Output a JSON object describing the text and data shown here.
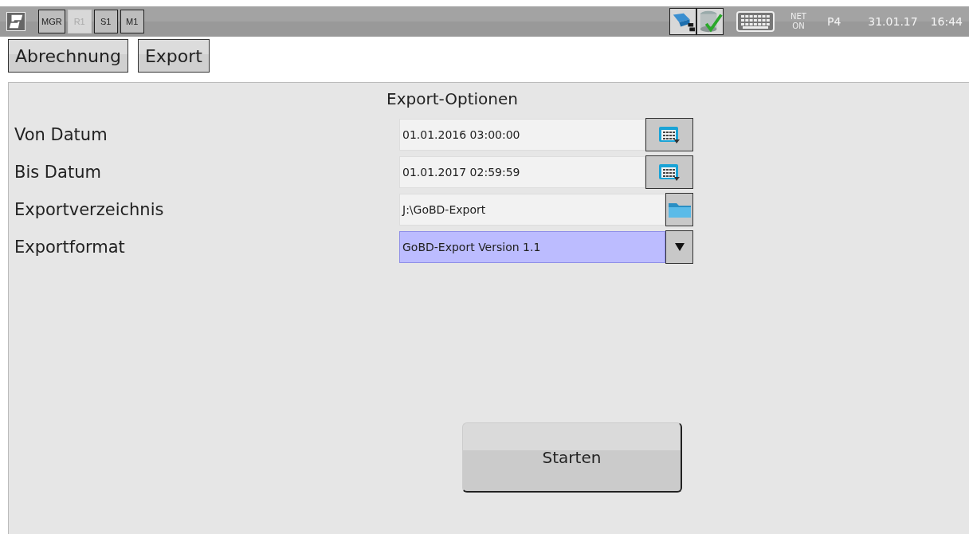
{
  "status_bar": {
    "modes": [
      {
        "label": "MGR",
        "disabled": false
      },
      {
        "label": "R1",
        "disabled": true
      },
      {
        "label": "S1",
        "disabled": false
      },
      {
        "label": "M1",
        "disabled": false
      }
    ],
    "net": [
      "NET",
      "ON"
    ],
    "printer": "P4",
    "date": "31.01.17",
    "time": "16:44"
  },
  "tabs": [
    {
      "label": "Abrechnung"
    },
    {
      "label": "Export"
    }
  ],
  "panel": {
    "title": "Export-Optionen",
    "rows": [
      {
        "label": "Von Datum",
        "value": "01.01.2016 03:00:00",
        "kind": "date",
        "highlighted": false
      },
      {
        "label": "Bis Datum",
        "value": "01.01.2017 02:59:59",
        "kind": "date",
        "highlighted": false
      },
      {
        "label": "Exportverzeichnis",
        "value": "J:\\GoBD-Export",
        "kind": "folder",
        "highlighted": false
      },
      {
        "label": "Exportformat",
        "value": "GoBD-Export Version 1.1",
        "kind": "dropdown",
        "highlighted": true
      }
    ],
    "start_button": "Starten"
  }
}
